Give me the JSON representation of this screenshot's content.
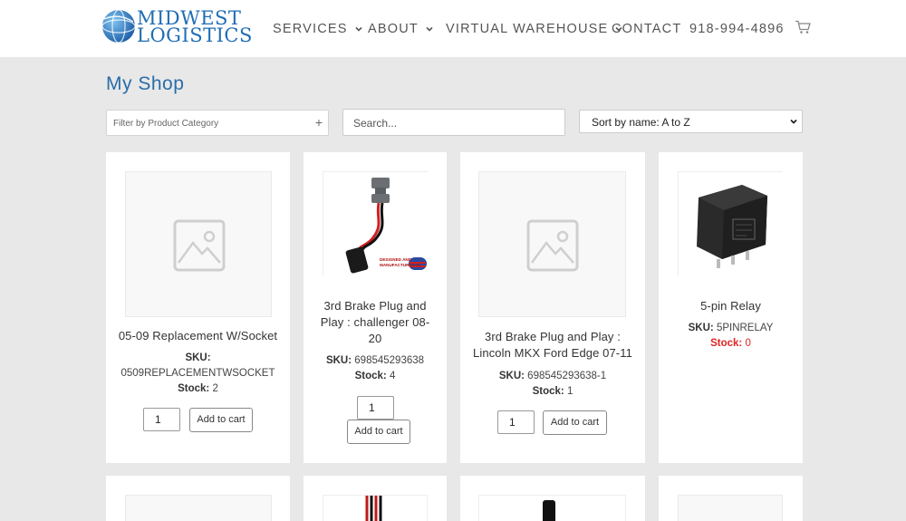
{
  "brand": {
    "line1": "MIDWEST",
    "line2": "LOGISTICS"
  },
  "nav": {
    "services": "SERVICES",
    "about": "ABOUT",
    "warehouse": "VIRTUAL WAREHOUSE",
    "contact": "CONTACT",
    "phone": "918-994-4896"
  },
  "shop": {
    "title": "My Shop",
    "filter_placeholder": "Filter by Product Category",
    "search_placeholder": "Search...",
    "sort_selected": "Sort by name: A to Z"
  },
  "labels": {
    "sku": "SKU:",
    "stock": "Stock:",
    "add_to_cart": "Add to cart"
  },
  "products": [
    {
      "name": "05-09 Replacement W/Socket",
      "sku": "0509REPLACEMENTWSOCKET",
      "stock": "2",
      "qty": "1"
    },
    {
      "name_l1": "3rd Brake Plug and",
      "name_l2": "Play : challenger 08-",
      "name_l3": "20",
      "sku": "698545293638",
      "stock": "4",
      "qty": "1",
      "image_text_1": "DESIGNED AND",
      "image_text_2": "MANUFACTURED IN"
    },
    {
      "name_l1": "3rd Brake Plug and Play :",
      "name_l2": "Lincoln MKX Ford Edge 07-11",
      "sku": "698545293638-1",
      "stock": "1",
      "qty": "1"
    },
    {
      "name": "5-pin Relay",
      "sku": "5PINRELAY",
      "stock": "0"
    }
  ],
  "colors": {
    "accent": "#2a6da8",
    "brand": "#1f6db5",
    "out_of_stock": "#e02424",
    "background": "#e8e8e8"
  }
}
